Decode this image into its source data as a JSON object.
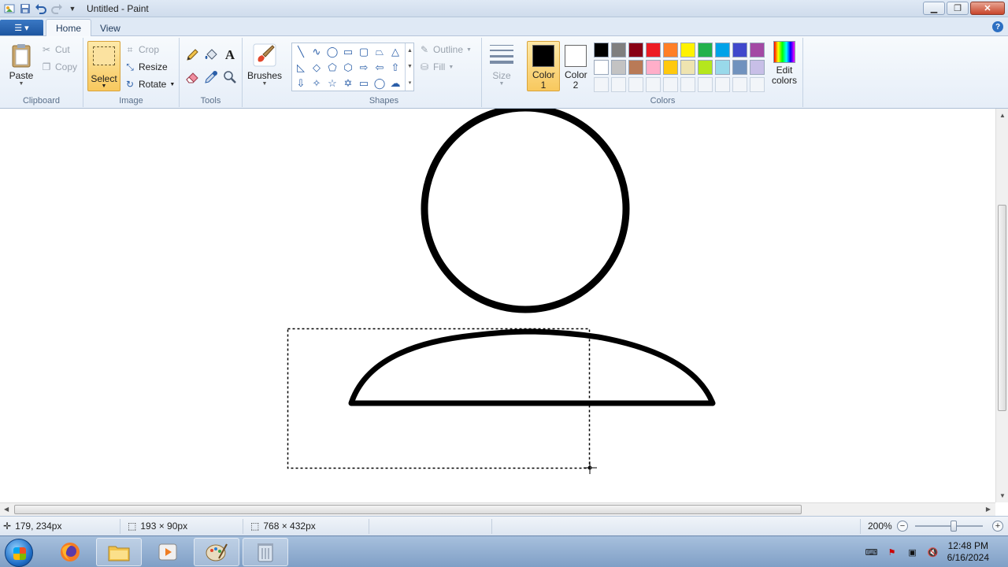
{
  "window": {
    "title": "Untitled - Paint",
    "minimize_icon": "minimize-icon",
    "restore_icon": "restore-icon",
    "close_icon": "close-icon"
  },
  "quick_access": {
    "icons": [
      "paint-app-icon",
      "save-icon",
      "undo-icon",
      "redo-icon",
      "customize-dropdown-icon"
    ]
  },
  "ribbon": {
    "tabs": [
      {
        "label": "Home",
        "active": true
      },
      {
        "label": "View",
        "active": false
      }
    ],
    "clipboard": {
      "label": "Clipboard",
      "paste": "Paste",
      "cut": "Cut",
      "copy": "Copy"
    },
    "image": {
      "label": "Image",
      "select": "Select",
      "crop": "Crop",
      "resize": "Resize",
      "rotate": "Rotate"
    },
    "tools": {
      "label": "Tools",
      "icons": [
        "pencil-icon",
        "fill-icon",
        "text-icon",
        "eraser-icon",
        "color-picker-icon",
        "magnifier-icon"
      ]
    },
    "brushes": {
      "label": "Brushes"
    },
    "shapes": {
      "label": "Shapes",
      "outline": "Outline",
      "fill": "Fill"
    },
    "size": {
      "label": "Size"
    },
    "colors": {
      "label": "Colors",
      "color1": "Color 1",
      "color1_value": "#000000",
      "color2": "Color 2",
      "color2_value": "#ffffff",
      "edit": "Edit colors",
      "palette_row1": [
        "#000000",
        "#7f7f7f",
        "#880015",
        "#ed1c24",
        "#ff7f27",
        "#fff200",
        "#22b14c",
        "#00a2e8",
        "#3f48cc",
        "#a349a4"
      ],
      "palette_row2": [
        "#ffffff",
        "#c3c3c3",
        "#b97a57",
        "#ffaec9",
        "#ffc90e",
        "#efe4b0",
        "#b5e61d",
        "#99d9ea",
        "#7092be",
        "#c8bfe7"
      ]
    }
  },
  "status": {
    "cursor_pos": "179, 234px",
    "selection_size": "193 × 90px",
    "image_size": "768 × 432px",
    "zoom": "200%"
  },
  "taskbar": {
    "time": "12:48 PM",
    "date": "6/16/2024",
    "apps": [
      "firefox-icon",
      "file-explorer-icon",
      "media-player-icon",
      "paint-icon",
      "recycle-bin-icon"
    ]
  }
}
